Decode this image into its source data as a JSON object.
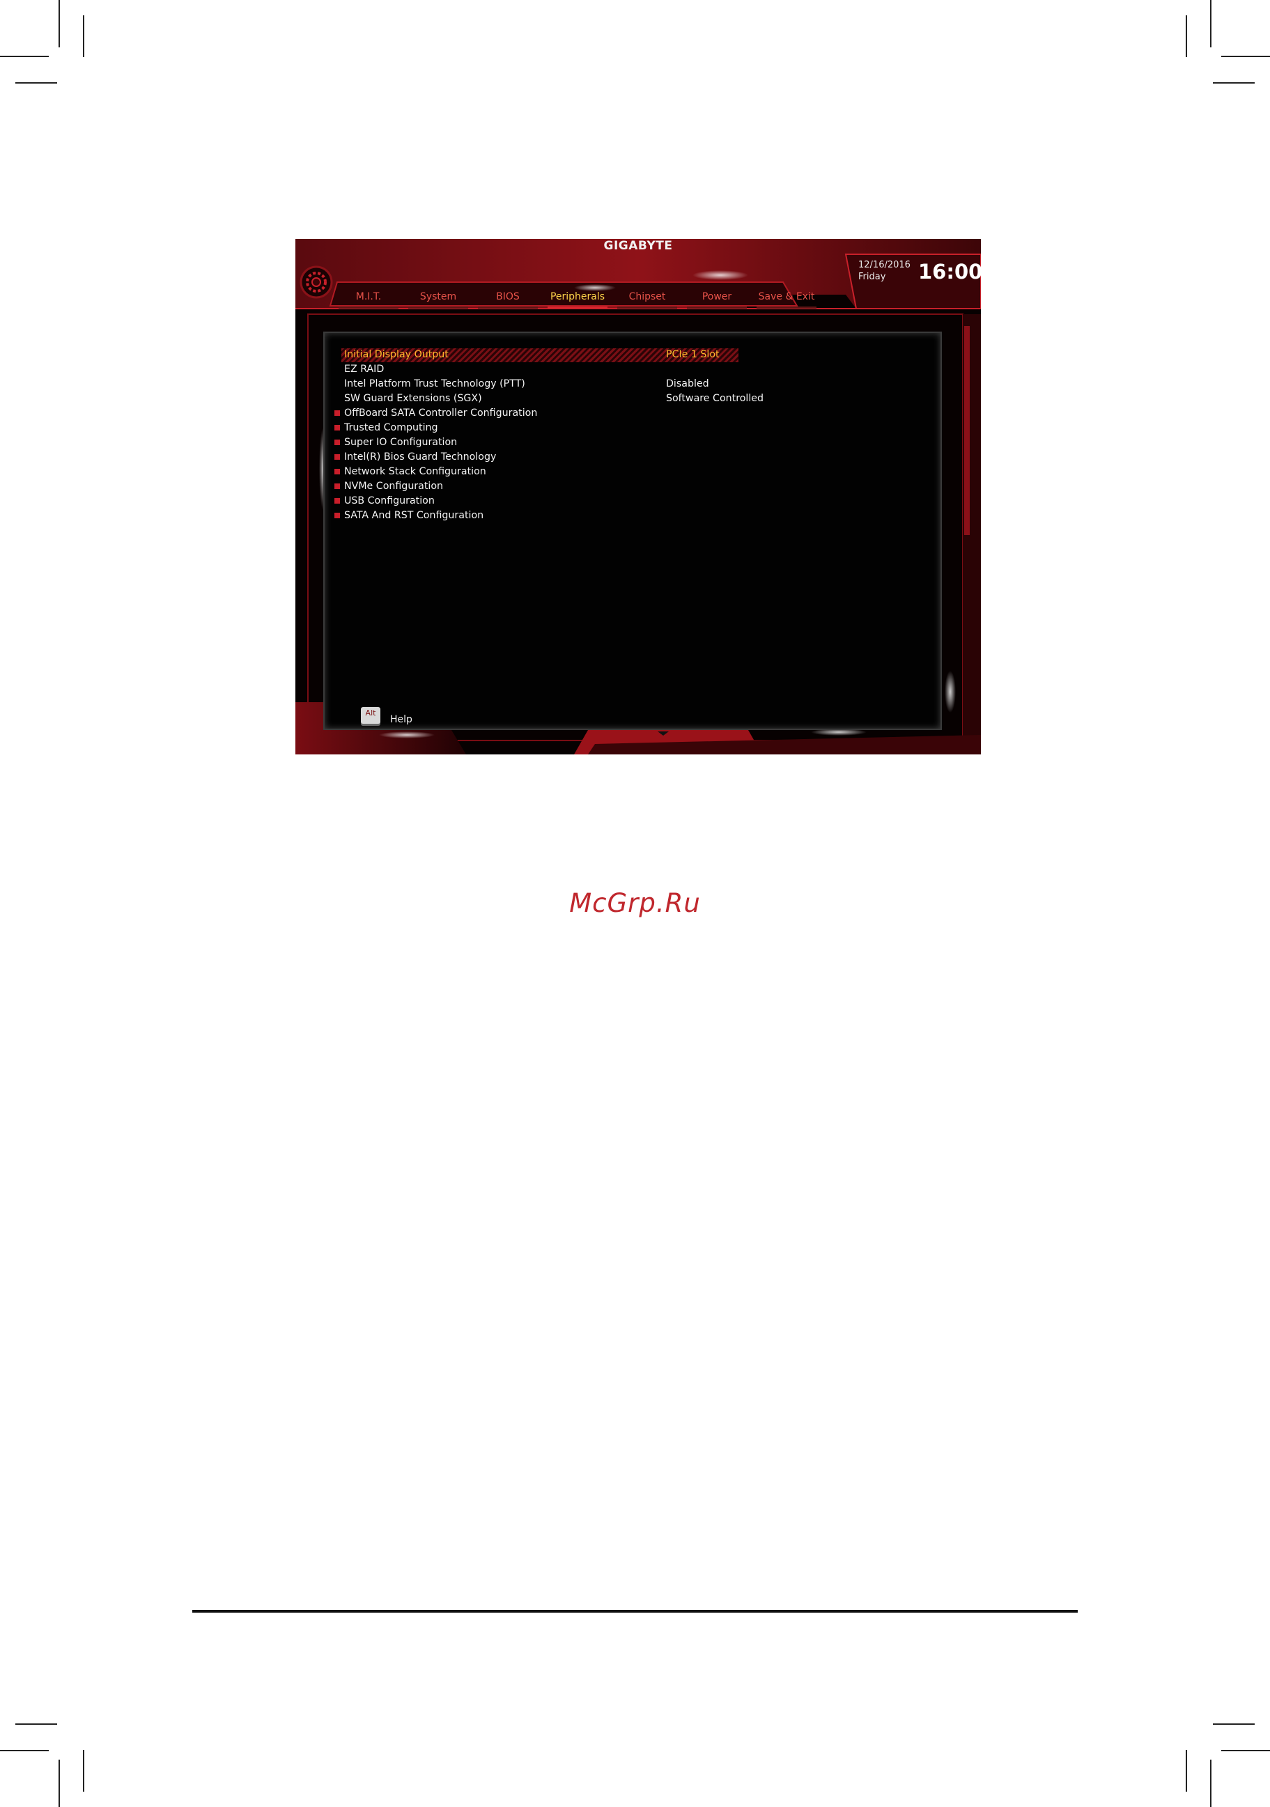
{
  "bios": {
    "brand": "GIGABYTE",
    "date": "12/16/2016",
    "day": "Friday",
    "time": "16:00",
    "accent_color": "#d8262e",
    "highlight_color": "#ffb92e",
    "tabs": [
      {
        "label": "M.I.T."
      },
      {
        "label": "System"
      },
      {
        "label": "BIOS"
      },
      {
        "label": "Peripherals",
        "active": true
      },
      {
        "label": "Chipset"
      },
      {
        "label": "Power"
      },
      {
        "label": "Save & Exit"
      }
    ],
    "menu_items": [
      {
        "label": "Initial Display Output",
        "value": "PCIe 1 Slot",
        "submenu": false,
        "selected": true
      },
      {
        "label": "EZ RAID",
        "value": "",
        "submenu": false
      },
      {
        "label": "Intel Platform Trust Technology (PTT)",
        "value": "Disabled",
        "submenu": false
      },
      {
        "label": "SW Guard Extensions (SGX)",
        "value": "Software Controlled",
        "submenu": false
      },
      {
        "label": "OffBoard SATA Controller Configuration",
        "value": "",
        "submenu": true
      },
      {
        "label": "Trusted Computing",
        "value": "",
        "submenu": true
      },
      {
        "label": "Super IO Configuration",
        "value": "",
        "submenu": true
      },
      {
        "label": "Intel(R) Bios Guard Technology",
        "value": "",
        "submenu": true
      },
      {
        "label": "Network Stack Configuration",
        "value": "",
        "submenu": true
      },
      {
        "label": "NVMe Configuration",
        "value": "",
        "submenu": true
      },
      {
        "label": "USB Configuration",
        "value": "",
        "submenu": true
      },
      {
        "label": "SATA And RST Configuration",
        "value": "",
        "submenu": true
      }
    ],
    "help_key": "Alt",
    "help_label": "Help"
  },
  "watermark": "McGrp.Ru"
}
